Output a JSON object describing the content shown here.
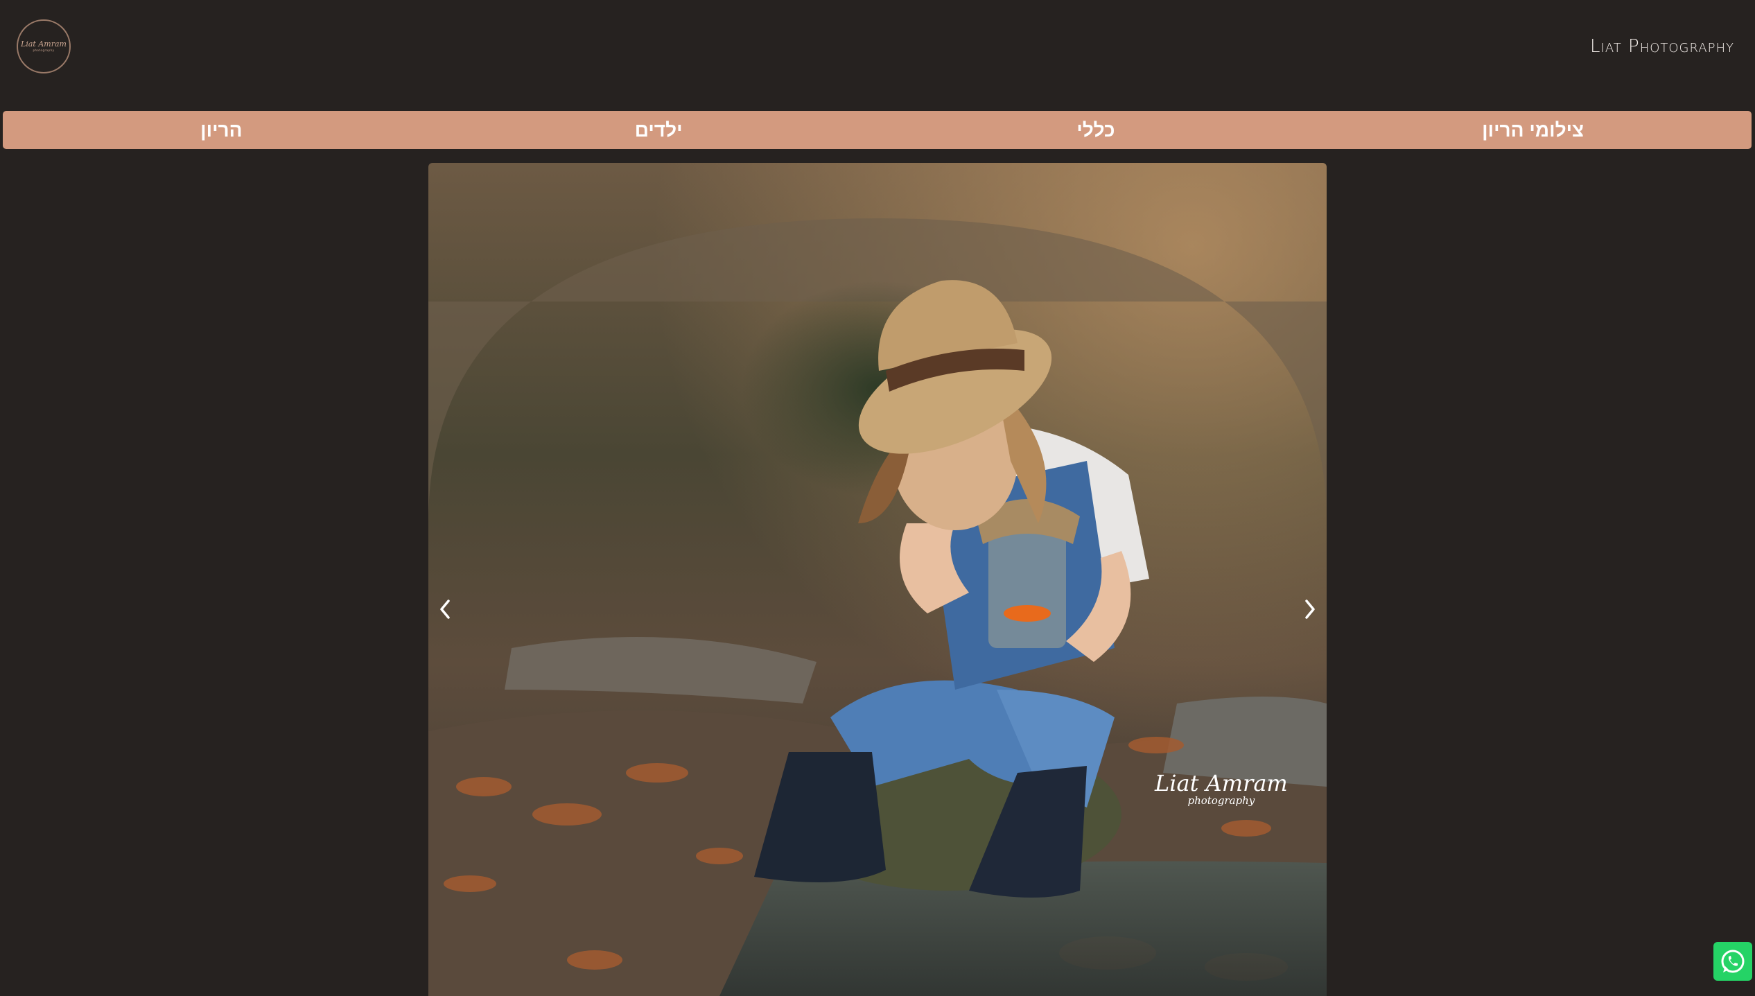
{
  "header": {
    "logo": {
      "line1": "Liat Amram",
      "line2": "photography"
    },
    "brand": "Liat Photography"
  },
  "nav": {
    "items": [
      {
        "label": "צילומי הריון"
      },
      {
        "label": "כללי"
      },
      {
        "label": "ילדים"
      },
      {
        "label": "הריון"
      }
    ]
  },
  "slider": {
    "prev_icon": "chevron-left-icon",
    "next_icon": "chevron-right-icon",
    "watermark": {
      "name": "Liat Amram",
      "sub": "photography"
    }
  },
  "whatsapp": {
    "icon": "whatsapp-icon",
    "color": "#25d366"
  },
  "colors": {
    "background": "#262220",
    "nav": "#d39a7f"
  }
}
